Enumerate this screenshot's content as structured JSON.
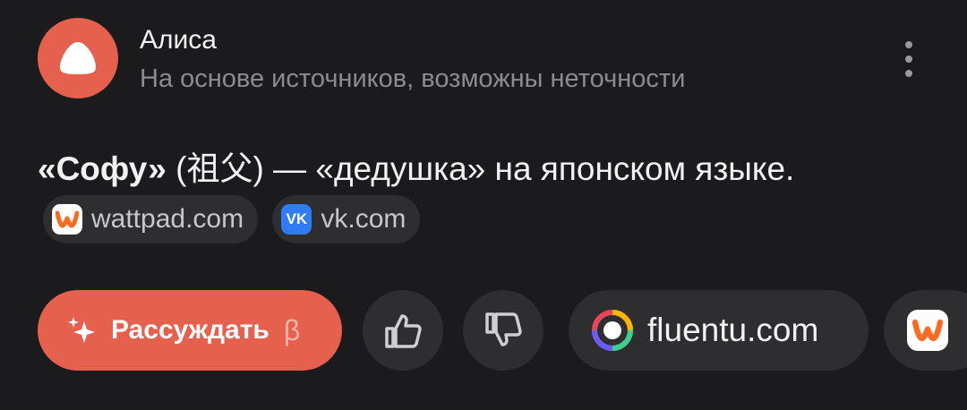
{
  "header": {
    "title": "Алиса",
    "subtitle": "На основе источников, возможны неточности",
    "avatar_icon": "alice-logo-icon",
    "more_icon": "more-vertical-icon"
  },
  "answer": {
    "term": "«Софу»",
    "kanji": "(祖父)",
    "rest": "— «дедушка» на японском языке.",
    "sources": [
      {
        "label": "wattpad.com",
        "icon": "wattpad-icon"
      },
      {
        "label": "vk.com",
        "icon": "vk-icon"
      }
    ]
  },
  "actions": {
    "reason_label": "Рассуждать",
    "reason_beta": "β",
    "like_icon": "thumbs-up-icon",
    "dislike_icon": "thumbs-down-icon",
    "source_label": "fluentu.com",
    "source_icon": "fluentu-icon",
    "partial_source_icon": "wattpad-icon"
  },
  "colors": {
    "background": "#1b1b1d",
    "accent": "#e6604e",
    "chip": "#2e2e31",
    "muted_text": "#8c8c90"
  }
}
